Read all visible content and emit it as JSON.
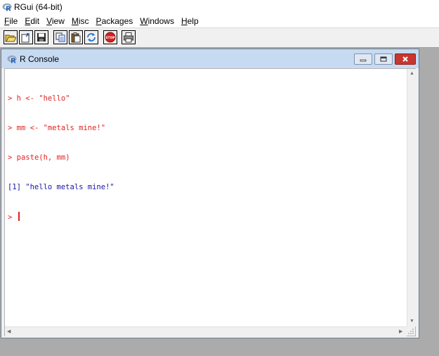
{
  "app": {
    "title": "RGui (64-bit)"
  },
  "menu": [
    {
      "label": "File",
      "mnemonic": "F",
      "rest": "ile"
    },
    {
      "label": "Edit",
      "mnemonic": "E",
      "rest": "dit"
    },
    {
      "label": "View",
      "mnemonic": "V",
      "rest": "iew"
    },
    {
      "label": "Misc",
      "mnemonic": "M",
      "rest": "isc"
    },
    {
      "label": "Packages",
      "mnemonic": "P",
      "rest": "ackages"
    },
    {
      "label": "Windows",
      "mnemonic": "W",
      "rest": "indows"
    },
    {
      "label": "Help",
      "mnemonic": "H",
      "rest": "elp"
    }
  ],
  "toolbar": {
    "buttons": [
      "open-script-icon",
      "load-workspace-icon",
      "save-icon",
      "copy-icon",
      "paste-icon",
      "copy-paste-icon",
      "stop-icon",
      "print-icon"
    ],
    "stop_label": "STOP"
  },
  "console": {
    "title": "R Console",
    "lines": [
      {
        "prompt": "> ",
        "text": "h <- \"hello\"",
        "kind": "input"
      },
      {
        "prompt": "> ",
        "text": "mm <- \"metals mine!\"",
        "kind": "input"
      },
      {
        "prompt": "> ",
        "text": "paste(h, mm)",
        "kind": "input"
      },
      {
        "prompt": "",
        "text": "[1] \"hello metals mine!\"",
        "kind": "output"
      }
    ],
    "current_prompt": "> ",
    "colors": {
      "input": "#e22222",
      "output": "#1515a8",
      "title_bg": "#c6daf2",
      "close": "#c7372f"
    }
  }
}
